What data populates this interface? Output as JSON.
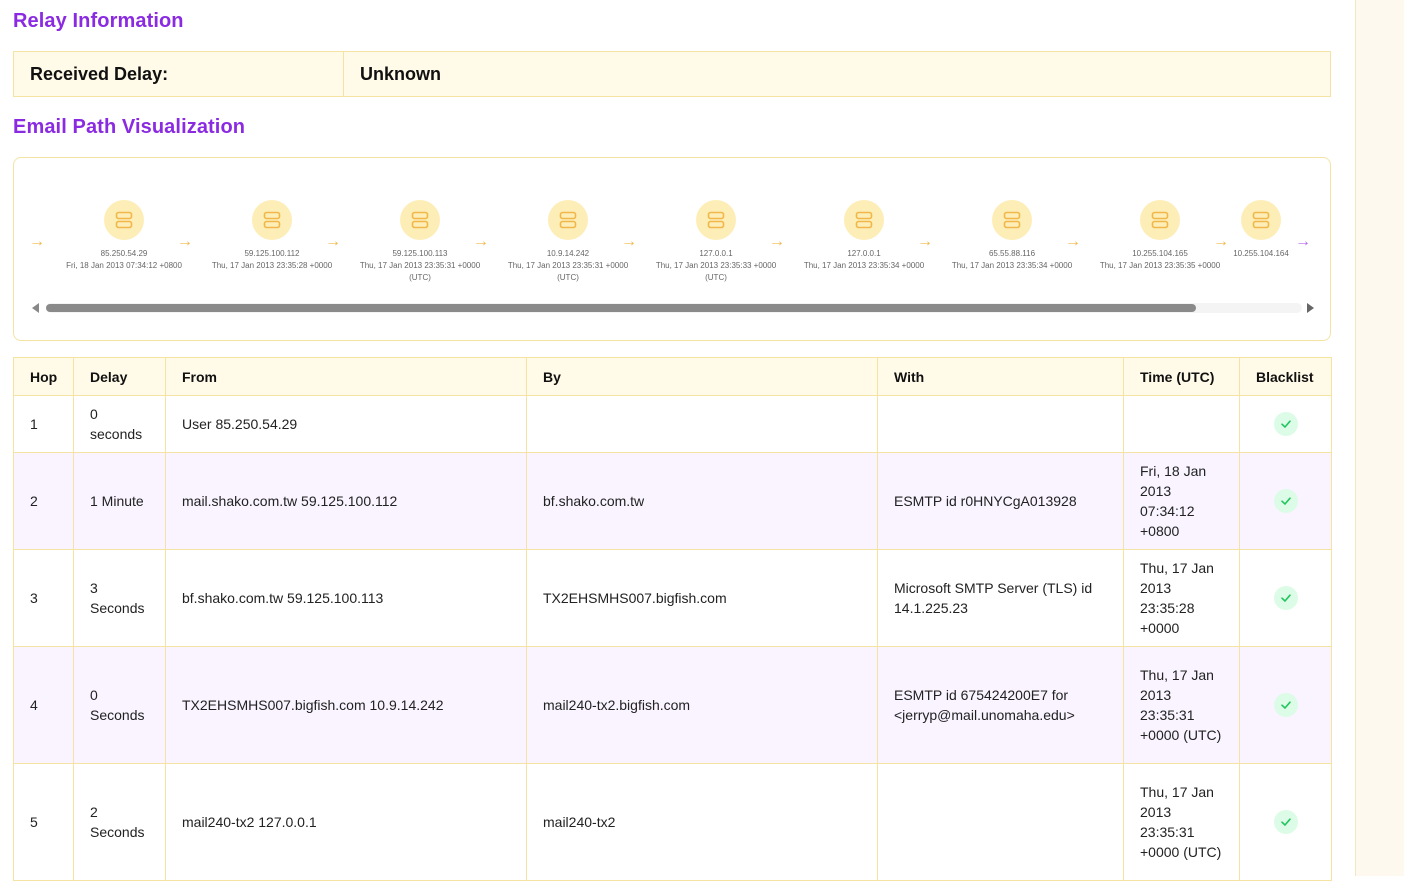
{
  "relay": {
    "title": "Relay Information",
    "received_delay_label": "Received Delay:",
    "received_delay_value": "Unknown"
  },
  "path": {
    "title": "Email Path Visualization",
    "icon": "server-icon",
    "nodes": [
      {
        "ip": "85.250.54.29",
        "time": "Fri, 18 Jan 2013 07:34:12 +0800"
      },
      {
        "ip": "59.125.100.112",
        "time": "Thu, 17 Jan 2013 23:35:28 +0000"
      },
      {
        "ip": "59.125.100.113",
        "time": "Thu, 17 Jan 2013 23:35:31 +0000 (UTC)"
      },
      {
        "ip": "10.9.14.242",
        "time": "Thu, 17 Jan 2013 23:35:31 +0000 (UTC)"
      },
      {
        "ip": "127.0.0.1",
        "time": "Thu, 17 Jan 2013 23:35:33 +0000 (UTC)"
      },
      {
        "ip": "127.0.0.1",
        "time": "Thu, 17 Jan 2013 23:35:34 +0000"
      },
      {
        "ip": "65.55.88.116",
        "time": "Thu, 17 Jan 2013 23:35:34 +0000"
      },
      {
        "ip": "10.255.104.165",
        "time": "Thu, 17 Jan 2013 23:35:35 +0000"
      },
      {
        "ip": "10.255.104.164",
        "time": ""
      }
    ]
  },
  "table": {
    "headers": [
      "Hop",
      "Delay",
      "From",
      "By",
      "With",
      "Time (UTC)",
      "Blacklist"
    ],
    "rows": [
      {
        "hop": "1",
        "delay": "0 seconds",
        "from": "User 85.250.54.29",
        "by": "",
        "with": "",
        "time": "",
        "blacklist": "clean"
      },
      {
        "hop": "2",
        "delay": "1 Minute",
        "from": "mail.shako.com.tw 59.125.100.112",
        "by": "bf.shako.com.tw",
        "with": "ESMTP id r0HNYCgA013928",
        "time": "Fri, 18 Jan 2013 07:34:12 +0800",
        "blacklist": "clean"
      },
      {
        "hop": "3",
        "delay": "3 Seconds",
        "from": "bf.shako.com.tw 59.125.100.113",
        "by": "TX2EHSMHS007.bigfish.com",
        "with": "Microsoft SMTP Server (TLS) id 14.1.225.23",
        "time": "Thu, 17 Jan 2013 23:35:28 +0000",
        "blacklist": "clean"
      },
      {
        "hop": "4",
        "delay": "0 Seconds",
        "from": "TX2EHSMHS007.bigfish.com 10.9.14.242",
        "by": "mail240-tx2.bigfish.com",
        "with": "ESMTP id 675424200E7 for <jerryp@mail.unomaha.edu>",
        "time": "Thu, 17 Jan 2013 23:35:31 +0000 (UTC)",
        "blacklist": "clean"
      },
      {
        "hop": "5",
        "delay": "2 Seconds",
        "from": "mail240-tx2 127.0.0.1",
        "by": "mail240-tx2",
        "with": "",
        "time": "Thu, 17 Jan 2013 23:35:31 +0000 (UTC)",
        "blacklist": "clean"
      }
    ]
  },
  "colors": {
    "accent": "#8a2be2",
    "check": "#22c55e"
  }
}
